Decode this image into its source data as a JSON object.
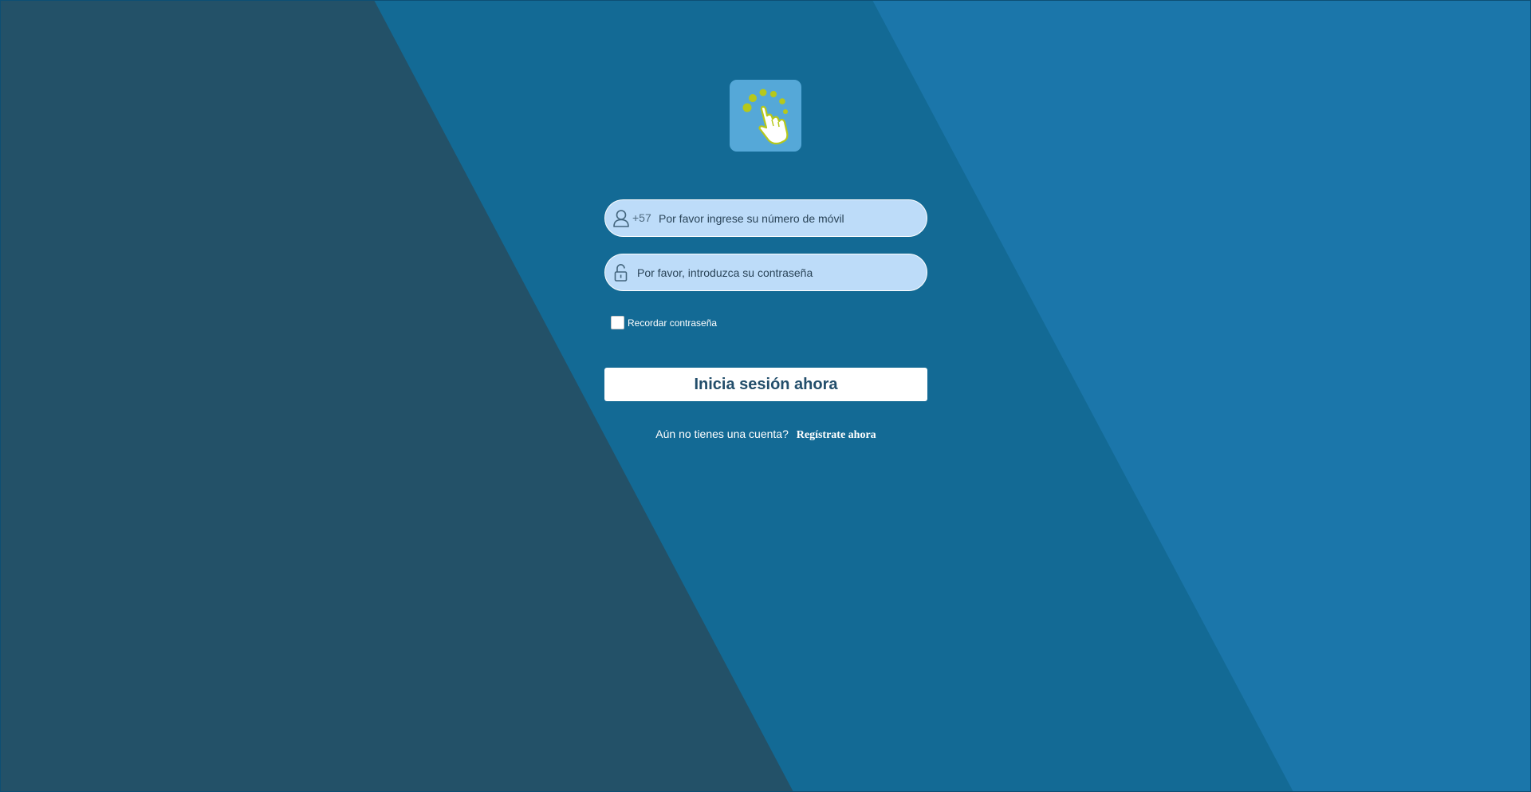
{
  "login": {
    "phone_prefix": "+57",
    "phone_placeholder": "Por favor ingrese su número de móvil",
    "password_placeholder": "Por favor, introduzca su contraseña",
    "remember_label": "Recordar contraseña",
    "submit_label": "Inicia sesión ahora",
    "signup_prompt": "Aún no tienes una cuenta?",
    "signup_link": "Regístrate ahora"
  },
  "icons": {
    "logo": "tap-hand-logo-icon",
    "phone_field": "user-icon",
    "password_field": "lock-open-icon"
  },
  "colors": {
    "background_dark": "#235168",
    "background_mid": "#136a95",
    "background_light": "#1b76aa",
    "field_background": "#bddcf9",
    "logo_background": "#55a8d8",
    "logo_accent": "#b6c81b",
    "button_text": "#234e6b"
  }
}
